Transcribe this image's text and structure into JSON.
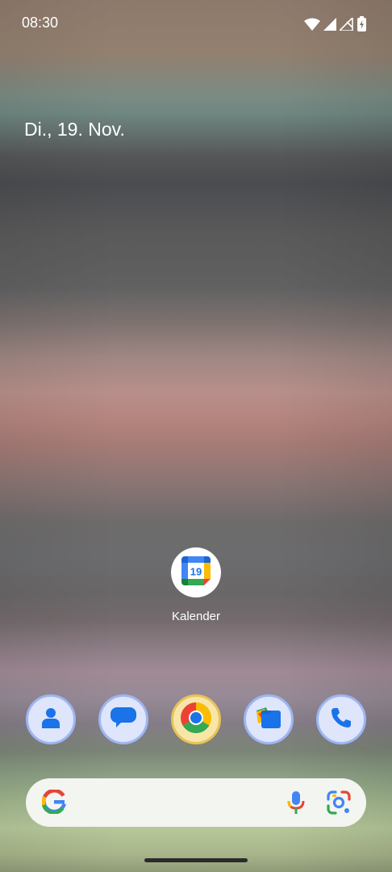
{
  "status_bar": {
    "time": "08:30",
    "icons": [
      "wifi-icon",
      "signal-icon",
      "signal-no-service-icon",
      "battery-charging-icon"
    ]
  },
  "home": {
    "date": "Di., 19. Nov.",
    "app": {
      "label": "Kalender",
      "icon": "calendar-icon",
      "icon_day": "19"
    }
  },
  "dock": [
    {
      "name": "contacts",
      "icon": "contacts-icon"
    },
    {
      "name": "messages",
      "icon": "messages-icon"
    },
    {
      "name": "chrome",
      "icon": "chrome-icon"
    },
    {
      "name": "files",
      "icon": "files-icon"
    },
    {
      "name": "phone",
      "icon": "phone-icon"
    }
  ],
  "search_bar": {
    "icons": [
      "google-g-icon",
      "microphone-icon",
      "google-lens-icon"
    ]
  },
  "colors": {
    "google_blue": "#4285F4",
    "google_red": "#EA4335",
    "google_yellow": "#FBBC05",
    "google_green": "#34A853"
  }
}
